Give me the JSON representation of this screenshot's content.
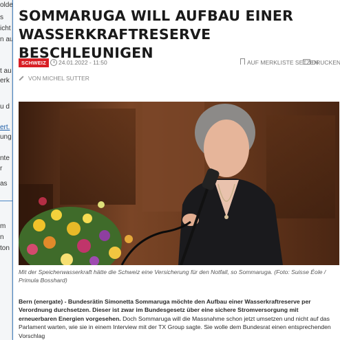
{
  "background": {
    "fragments": [
      {
        "text": "olde",
        "link": false
      },
      {
        "text": "s",
        "link": false
      },
      {
        "text": "icht",
        "link": false
      },
      {
        "text": "n au",
        "link": false
      },
      {
        "text": "t au",
        "link": false
      },
      {
        "text": "erk",
        "link": false
      },
      {
        "text": "u d",
        "link": false
      },
      {
        "text": "ert.",
        "link": true
      },
      {
        "text": "ung",
        "link": false
      },
      {
        "text": "nte",
        "link": false
      },
      {
        "text": "r",
        "link": false
      },
      {
        "text": "as",
        "link": false
      },
      {
        "text": "m",
        "link": false
      },
      {
        "text": "n",
        "link": false
      },
      {
        "text": "ton",
        "link": false
      }
    ]
  },
  "article": {
    "headline": "SOMMARUGA WILL AUFBAU EINER WASSERKRAFTRESERVE BESCHLEUNIGEN",
    "category": "SCHWEIZ",
    "date": "24.01.2022 - 11:50",
    "bookmark_label": "AUF MERKLISTE SETZEN",
    "print_label": "DRUCKEN",
    "author": "VON MICHEL SUTTER",
    "photo_alt": "Simonetta Sommaruga am Rednerpult",
    "caption": "Mit der Speicherwasserkraft hätte die Schweiz eine Versicherung für den Notfall, so Sommaruga. (Foto: Suisse Éole / Primula Bosshard)",
    "lead_bold": "Bern (energate) - Bundesrätin Simonetta Sommaruga möchte den Aufbau einer Wasserkraftreserve per Verordnung durchsetzen. Dieser ist zwar im Bundesgesetz über eine sichere Stromversorgung mit erneuerbaren Energien vorgesehen.",
    "lead_rest": " Doch Sommaruga will die Massnahme schon jetzt umsetzen und nicht auf das Parlament warten, wie sie in einem Interview mit der TX Group sagte. Sie wolle dem Bundesrat einen entsprechenden Vorschlag"
  },
  "colors": {
    "badge": "#d81e24",
    "popup_border": "#3f7fc0",
    "link": "#1f5fa8"
  }
}
